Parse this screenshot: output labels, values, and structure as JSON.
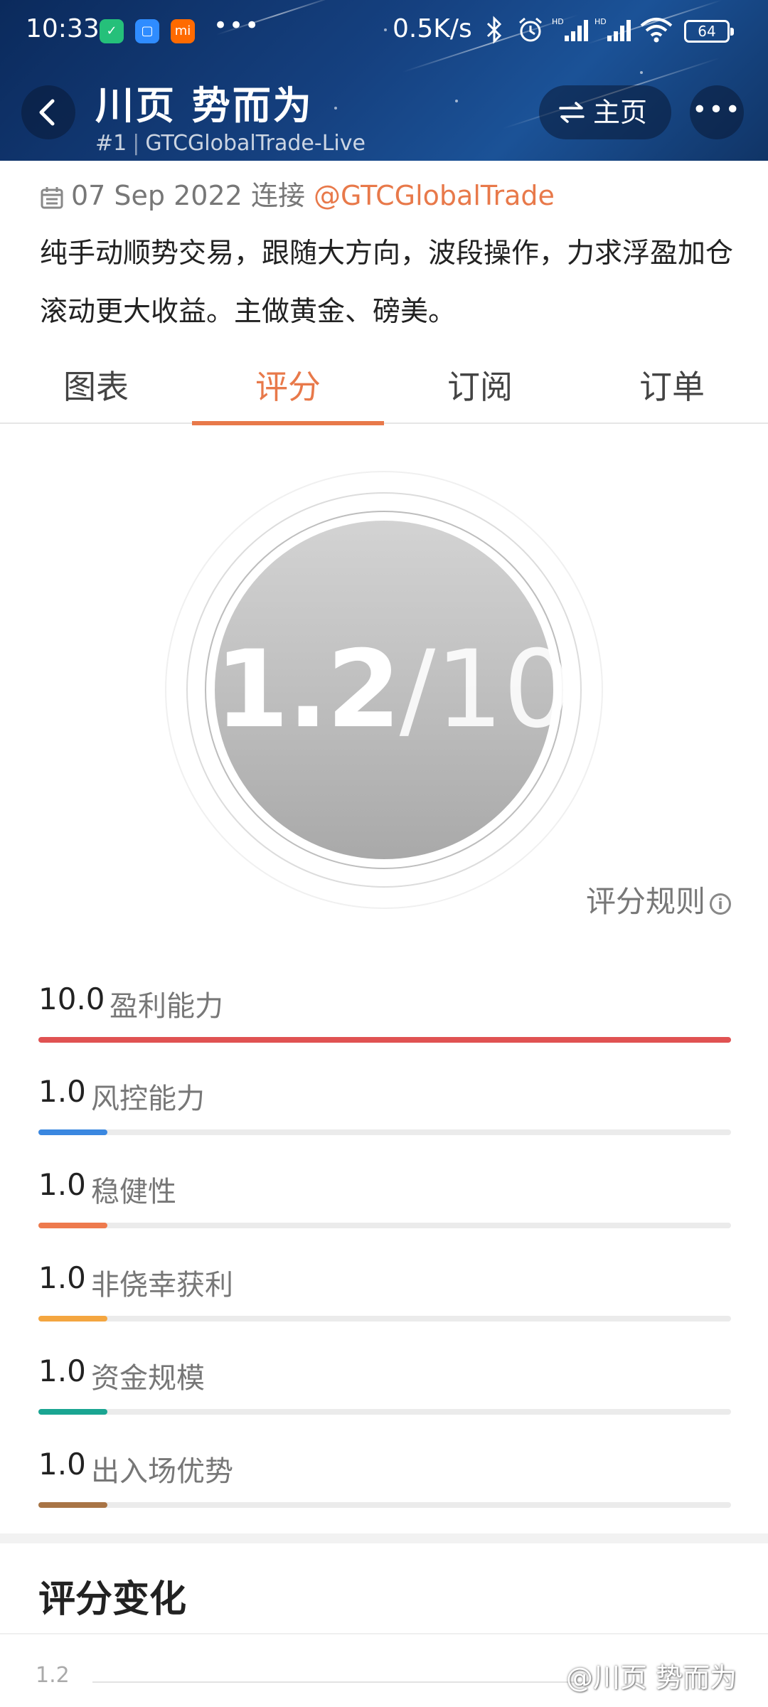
{
  "status_bar": {
    "time": "10:33",
    "net_speed": "0.5K/s",
    "battery": "64",
    "more": "•••"
  },
  "header": {
    "title": "川页 势而为",
    "rank": "#1",
    "account": "GTCGlobalTrade-Live",
    "home_label": "主页",
    "more_label": "•••"
  },
  "info": {
    "date": "07 Sep 2022",
    "connect_text": "连接",
    "broker_link": "@GTCGlobalTrade",
    "description": "纯手动顺势交易，跟随大方向，波段操作，力求浮盈加仓滚动更大收益。主做黄金、磅美。"
  },
  "tabs": [
    {
      "label": "图表"
    },
    {
      "label": "评分"
    },
    {
      "label": "订阅"
    },
    {
      "label": "订单"
    }
  ],
  "active_tab": "评分",
  "score": {
    "value": "1.2",
    "slash": "/",
    "max": "10",
    "rules_label": "评分规则",
    "info_glyph": "i"
  },
  "metrics": [
    {
      "value": "10.0",
      "label": "盈利能力",
      "progress": 1.0,
      "color": "#e05252"
    },
    {
      "value": "1.0",
      "label": "风控能力",
      "progress": 0.1,
      "color": "#3a87e0"
    },
    {
      "value": "1.0",
      "label": "稳健性",
      "progress": 0.1,
      "color": "#ee7a4d"
    },
    {
      "value": "1.0",
      "label": "非侥幸获利",
      "progress": 0.1,
      "color": "#f4a640"
    },
    {
      "value": "1.0",
      "label": "资金规模",
      "progress": 0.1,
      "color": "#1aa592"
    },
    {
      "value": "1.0",
      "label": "出入场优势",
      "progress": 0.1,
      "color": "#a87445"
    }
  ],
  "score_history": {
    "title": "评分变化",
    "y_tick": "1.2"
  },
  "watermark": "@川页 势而为"
}
